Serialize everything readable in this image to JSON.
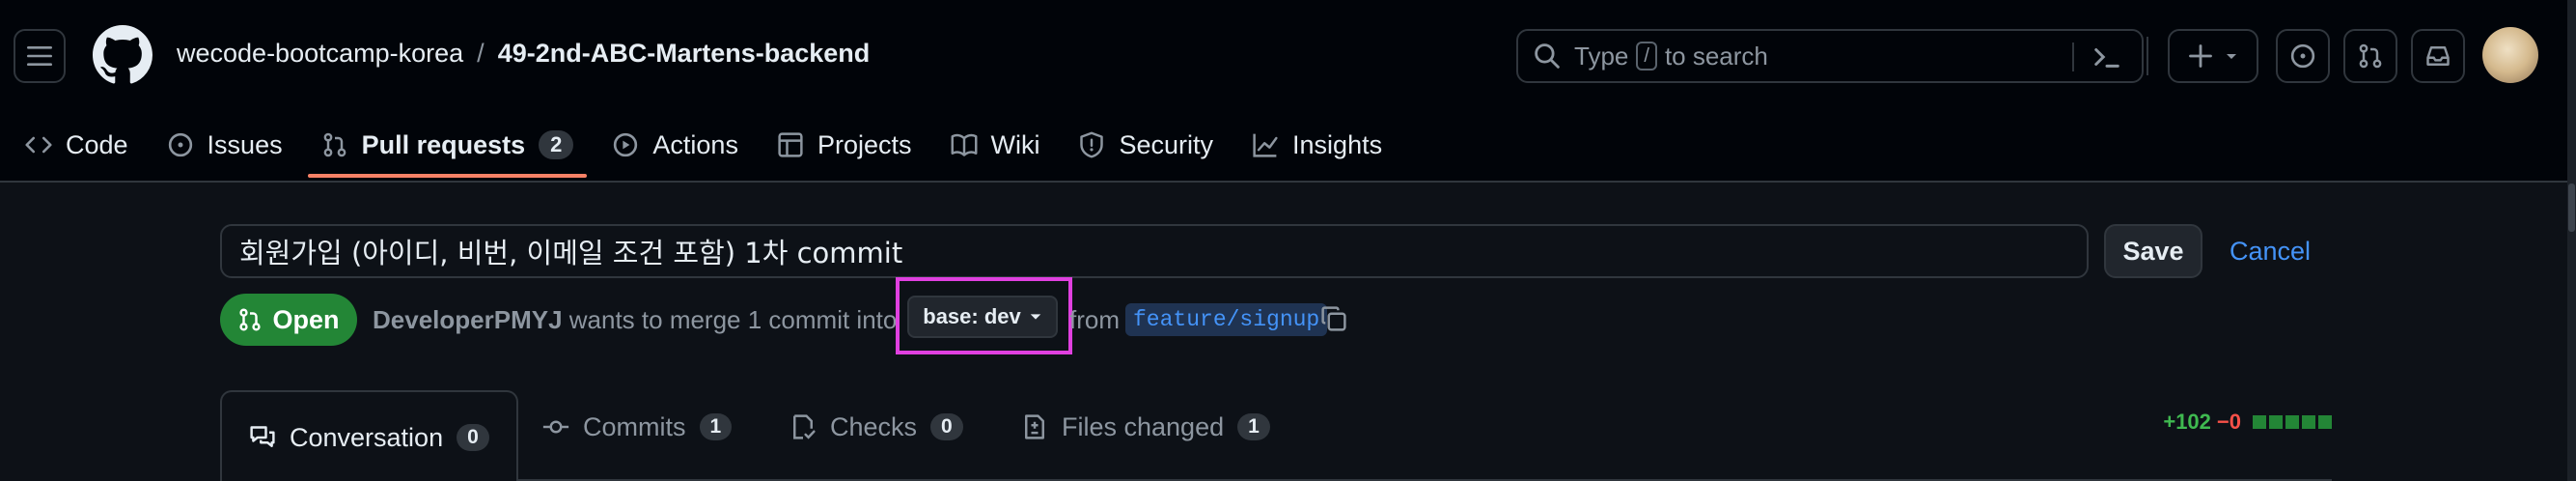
{
  "header": {
    "owner": "wecode-bootcamp-korea",
    "separator": "/",
    "repo": "49-2nd-ABC-Martens-backend",
    "search": {
      "prefix": "Type",
      "key": "/",
      "suffix": "to search"
    }
  },
  "nav": {
    "items": [
      {
        "label": "Code",
        "icon": "code-icon"
      },
      {
        "label": "Issues",
        "icon": "issue-opened-icon"
      },
      {
        "label": "Pull requests",
        "icon": "git-pull-request-icon",
        "count": "2",
        "active": true
      },
      {
        "label": "Actions",
        "icon": "play-icon"
      },
      {
        "label": "Projects",
        "icon": "table-icon"
      },
      {
        "label": "Wiki",
        "icon": "book-icon"
      },
      {
        "label": "Security",
        "icon": "shield-icon"
      },
      {
        "label": "Insights",
        "icon": "graph-icon"
      }
    ]
  },
  "pr": {
    "title_value": "회원가입 (아이디, 비번, 이메일 조건 포함) 1차 commit",
    "save_label": "Save",
    "cancel_label": "Cancel",
    "state": "Open",
    "author": "DeveloperPMYJ",
    "merge_text": "wants to merge 1 commit into",
    "base_label": "base: dev",
    "from_text": "from",
    "head_branch": "feature/signup"
  },
  "tabs": [
    {
      "label": "Conversation",
      "count": "0",
      "icon": "comment-discussion-icon"
    },
    {
      "label": "Commits",
      "count": "1",
      "icon": "git-commit-icon"
    },
    {
      "label": "Checks",
      "count": "0",
      "icon": "checklist-icon"
    },
    {
      "label": "Files changed",
      "count": "1",
      "icon": "file-diff-icon"
    }
  ],
  "diffstat": {
    "additions": "+102",
    "deletions": "−0",
    "blocks": 5
  },
  "colors": {
    "accent": "#f78166",
    "open": "#238636",
    "link": "#4493f8",
    "highlight": "#e040e0"
  }
}
